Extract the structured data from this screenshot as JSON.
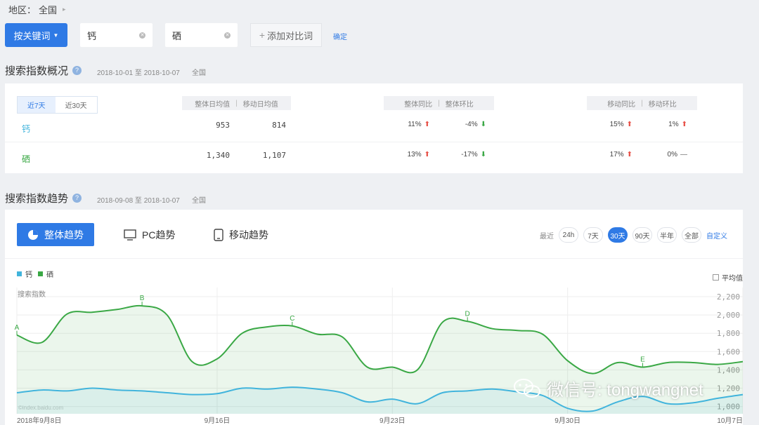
{
  "breadcrumb": {
    "label": "地区：",
    "value": "全国"
  },
  "search": {
    "mode_button": "按关键词",
    "keywords": [
      "钙",
      "硒"
    ],
    "add_compare": "添加对比词",
    "confirm": "确定"
  },
  "overview": {
    "title": "搜索指数概况",
    "date_range": "2018-10-01 至 2018-10-07",
    "region": "全国",
    "period_tabs": [
      "近7天",
      "近30天"
    ],
    "headers": {
      "daily": [
        "整体日均值",
        "移动日均值"
      ],
      "yoy_qoq": [
        "整体同比",
        "整体环比"
      ],
      "mobile": [
        "移动同比",
        "移动环比"
      ]
    },
    "rows": [
      {
        "keyword": "钙",
        "color": "#41b4dc",
        "overall_avg": "953",
        "mobile_avg": "814",
        "overall_yoy": "11%",
        "overall_yoy_dir": "up",
        "overall_qoq": "-4%",
        "overall_qoq_dir": "down",
        "mobile_yoy": "15%",
        "mobile_yoy_dir": "up",
        "mobile_qoq": "1%",
        "mobile_qoq_dir": "up"
      },
      {
        "keyword": "硒",
        "color": "#3aa845",
        "overall_avg": "1,340",
        "mobile_avg": "1,107",
        "overall_yoy": "13%",
        "overall_yoy_dir": "up",
        "overall_qoq": "-17%",
        "overall_qoq_dir": "down",
        "mobile_yoy": "17%",
        "mobile_yoy_dir": "up",
        "mobile_qoq": "0%",
        "mobile_qoq_dir": "flat"
      }
    ]
  },
  "trend": {
    "title": "搜索指数趋势",
    "date_range": "2018-09-08 至 2018-10-07",
    "region": "全国",
    "tabs": [
      "整体趋势",
      "PC趋势",
      "移动趋势"
    ],
    "range_label": "最近",
    "ranges": [
      "24h",
      "7天",
      "30天",
      "90天",
      "半年",
      "全部"
    ],
    "selected_range": "30天",
    "custom": "自定义",
    "average_label": "平均值",
    "source_mark": "©index.baidu.com"
  },
  "watermark": "微信号: tongwangnet",
  "chart_data": {
    "type": "area",
    "ylabel": "搜索指数",
    "yticks": [
      1000,
      1200,
      1400,
      1600,
      1800,
      2000,
      2200
    ],
    "ytick_labels": [
      "1,000",
      "1,200",
      "1,400",
      "1,600",
      "1,800",
      "2,000",
      "2,200"
    ],
    "ylim": [
      920,
      2300
    ],
    "x_tick_labels": [
      {
        "index": 0,
        "label": "2018年9月8日"
      },
      {
        "index": 8,
        "label": "9月16日"
      },
      {
        "index": 15,
        "label": "9月23日"
      },
      {
        "index": 22,
        "label": "9月30日"
      },
      {
        "index": 29,
        "label": "10月7日"
      }
    ],
    "legend": [
      "钙",
      "硒"
    ],
    "series": [
      {
        "name": "硒",
        "color": "#3aa845",
        "values": [
          1780,
          1700,
          2010,
          2030,
          2060,
          2100,
          2000,
          1490,
          1520,
          1800,
          1870,
          1880,
          1790,
          1760,
          1430,
          1430,
          1400,
          1920,
          1930,
          1850,
          1830,
          1790,
          1500,
          1360,
          1480,
          1430,
          1480,
          1480,
          1460,
          1490
        ]
      },
      {
        "name": "钙",
        "color": "#41b4dc",
        "values": [
          1150,
          1180,
          1170,
          1200,
          1180,
          1170,
          1150,
          1130,
          1140,
          1200,
          1190,
          1210,
          1190,
          1150,
          1050,
          1080,
          1030,
          1150,
          1170,
          1190,
          1160,
          1120,
          980,
          950,
          1050,
          1110,
          1030,
          1040,
          1090,
          1130
        ]
      }
    ],
    "annotations": [
      {
        "label": "A",
        "index": 0,
        "series": "硒"
      },
      {
        "label": "B",
        "index": 5,
        "series": "硒"
      },
      {
        "label": "C",
        "index": 11,
        "series": "硒"
      },
      {
        "label": "D",
        "index": 18,
        "series": "硒"
      },
      {
        "label": "E",
        "index": 25,
        "series": "硒"
      }
    ],
    "grid": true
  }
}
